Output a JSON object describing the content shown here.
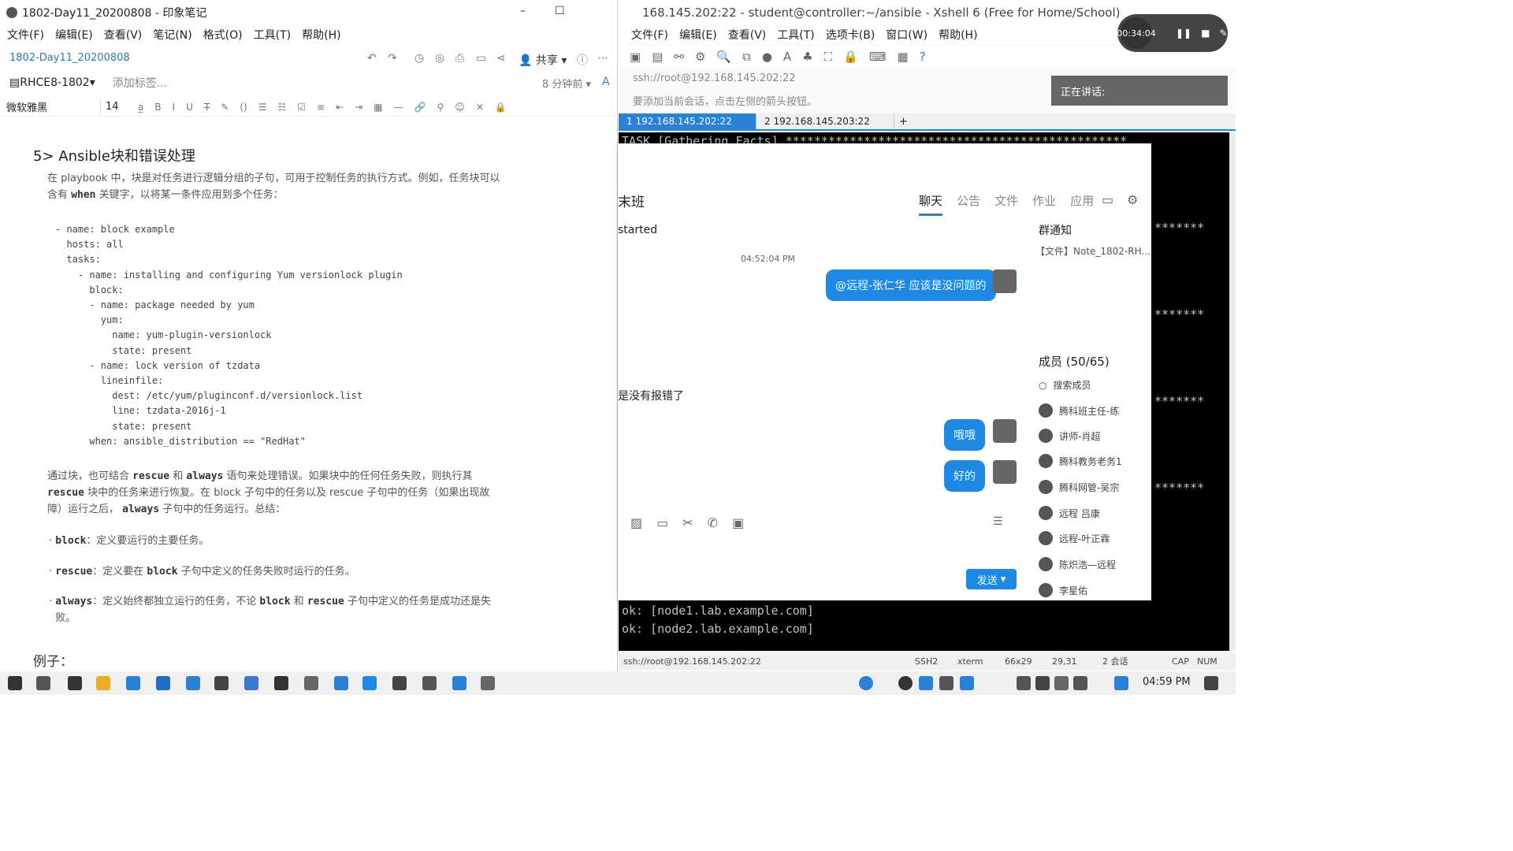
{
  "evernote": {
    "window_title": "1802-Day11_20200808 - 印象笔记",
    "menu": [
      "文件(F)",
      "编辑(E)",
      "查看(V)",
      "笔记(N)",
      "格式(O)",
      "工具(T)",
      "帮助(H)"
    ],
    "note_title": "1802-Day11_20200808",
    "share_label": "共享",
    "notebook": "RHCE8-1802",
    "add_tag": "添加标签...",
    "read_time": "8 分钟前",
    "font": "微软雅黑",
    "font_size": "14",
    "section_heading": "5> Ansible块和错误处理",
    "intro_1": "在 playbook 中，块是对任务进行逻辑分组的子句，可用于控制任务的执行方式。例如，任务块可以",
    "intro_2_pre": "含有",
    "intro_2_kw": "when",
    "intro_2_post": "关键字，以将某一条件应用到多个任务：",
    "code": "- name: block example\n  hosts: all\n  tasks:\n    - name: installing and configuring Yum versionlock plugin\n      block:\n      - name: package needed by yum\n        yum:\n          name: yum-plugin-versionlock\n          state: present\n      - name: lock version of tzdata\n        lineinfile:\n          dest: /etc/yum/pluginconf.d/versionlock.list\n          line: tzdata-2016j-1\n          state: present\n      when: ansible_distribution == \"RedHat\"",
    "p2_a": "通过块，也可结合",
    "p2_rescue": "rescue",
    "p2_and": "和",
    "p2_always": "always",
    "p2_b": "语句来处理错误。如果块中的任何任务失败，则执行其",
    "p2_c_kw": "rescue",
    "p2_c": "块中的任务来进行恢复。在 block 子句中的任务以及 rescue 子句中的任务（如果出现故",
    "p2_d_pre": "障）运行之后，",
    "p2_d_kw": "always",
    "p2_d": "子句中的任务运行。总结：",
    "b1_kw": "block",
    "b1": "：定义要运行的主要任务。",
    "b2_kw": "rescue",
    "b2_a": "：定义要在",
    "b2_kw2": "block",
    "b2_b": "子句中定义的任务失败时运行的任务。",
    "b3_kw": "always",
    "b3_a": "：定义始终都独立运行的任务，不论",
    "b3_kw2": "block",
    "b3_and": "和",
    "b3_kw3": "rescue",
    "b3_b": "子句中定义的任务是成功还是失",
    "b3_c": "败。",
    "example": "例子："
  },
  "xshell": {
    "window_title": "168.145.202:22 - student@controller:~/ansible - Xshell 6 (Free for Home/School)",
    "menu": [
      "文件(F)",
      "编辑(E)",
      "查看(V)",
      "工具(T)",
      "选项卡(B)",
      "窗口(W)",
      "帮助(H)"
    ],
    "address": "ssh://root@192.168.145.202:22",
    "hint": "要添加当前会话，点击左侧的箭头按钮。",
    "tab1": "1 192.168.145.202:22",
    "tab2": "2 192.168.145.203:22",
    "term_line1": "TASK [Gathering Facts] ************************************************",
    "term_ok1": "ok: [node1.lab.example.com]",
    "term_ok2": "ok: [node2.lab.example.com]",
    "stars": "*******",
    "status_addr": "ssh://root@192.168.145.202:22",
    "status_proto": "SSH2",
    "status_term": "xterm",
    "status_size": "66x29",
    "status_pos": "29,31",
    "status_sessions": "2 会话",
    "status_cap": "CAP",
    "status_num": "NUM"
  },
  "chat": {
    "group_name": "末班",
    "tabs": [
      "聊天",
      "公告",
      "文件",
      "作业",
      "应用"
    ],
    "started_text": "started",
    "timestamp": "04:52:04 PM",
    "msg1": "@远程-张仁华 应该是没问题的",
    "msg_left": "是没有报错了",
    "msg2": "哦哦",
    "msg3": "好的",
    "send": "发送",
    "notice_title": "群通知",
    "notice_file": "【文件】Note_1802-RH...",
    "members_title": "成员 (50/65)",
    "search_members": "搜索成员",
    "members": [
      "腾科班主任-练",
      "讲师-肖超",
      "腾科教务老务1",
      "腾科网管-吴宗",
      "远程 吕康",
      "远程-叶正霖",
      "陈炽浩—远程",
      "李星佑"
    ]
  },
  "recorder": {
    "time": "00:34:04",
    "speaking": "正在讲话:"
  },
  "taskbar": {
    "time": "04:59 PM"
  }
}
